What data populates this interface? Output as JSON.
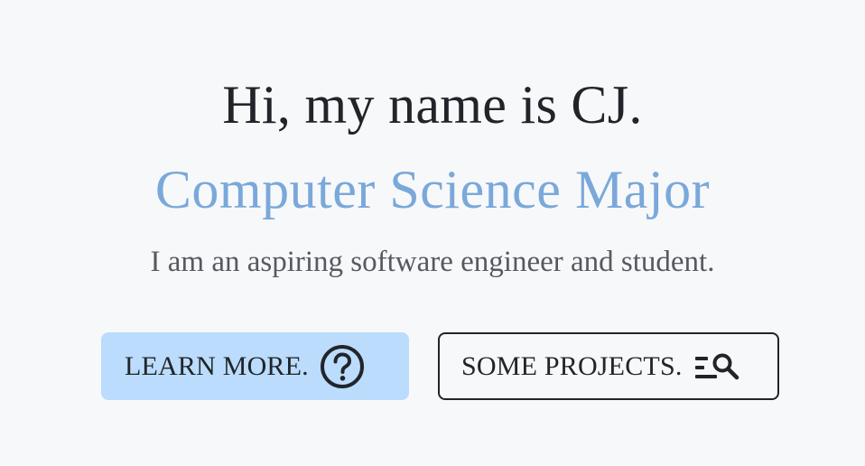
{
  "hero": {
    "greeting": "Hi, my name is CJ.",
    "role": "Computer Science Major",
    "tagline": "I am an aspiring software engineer and student."
  },
  "buttons": {
    "learn_more": {
      "label": "LEARN MORE.",
      "icon": "question-circle-icon"
    },
    "projects": {
      "label": "SOME PROJECTS.",
      "icon": "list-search-icon"
    }
  },
  "colors": {
    "background": "#f7f8fa",
    "heading": "#212529",
    "accent": "#7aa8da",
    "primary_button": "#bbdcfd"
  }
}
